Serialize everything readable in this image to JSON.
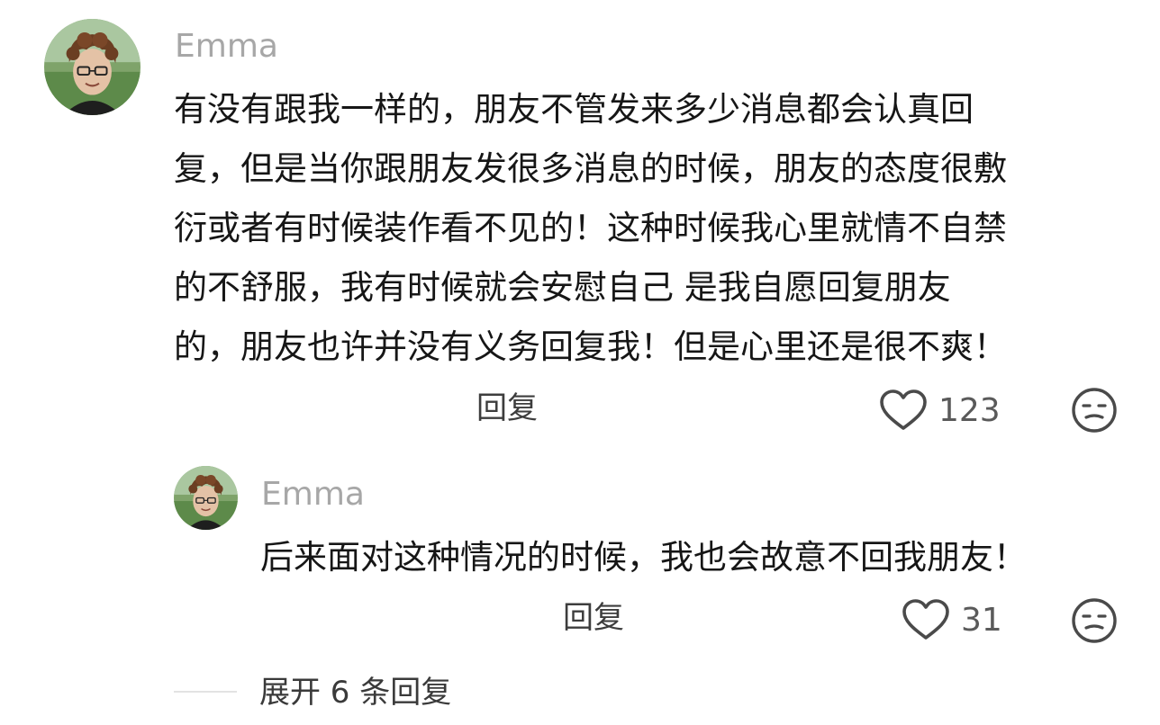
{
  "comment": {
    "username": "Emma",
    "lines": [
      "有没有跟我一样的，朋友不管发来多少消息都会认真回",
      "复，但是当你跟朋友发很多消息的时候，朋友的态度很敷",
      "衍或者有时候装作看不见的！这种时候我心里就情不自禁",
      "的不舒服，我有时候就会安慰自己 是我自愿回复朋友",
      "的，朋友也许并没有义务回复我！但是心里还是很不爽！"
    ],
    "reply_label": "回复",
    "like_count": "123"
  },
  "reply": {
    "username": "Emma",
    "text": "后来面对这种情况的时候，我也会故意不回我朋友！",
    "reply_label": "回复",
    "like_count": "31"
  },
  "expand": {
    "label": "展开 6 条回复"
  },
  "icons": {
    "like": "heart-outline-icon",
    "dislike": "unamused-face-icon"
  },
  "colors": {
    "username": "#a7a7a7",
    "text": "#161616",
    "icon": "#4a4a4a"
  }
}
